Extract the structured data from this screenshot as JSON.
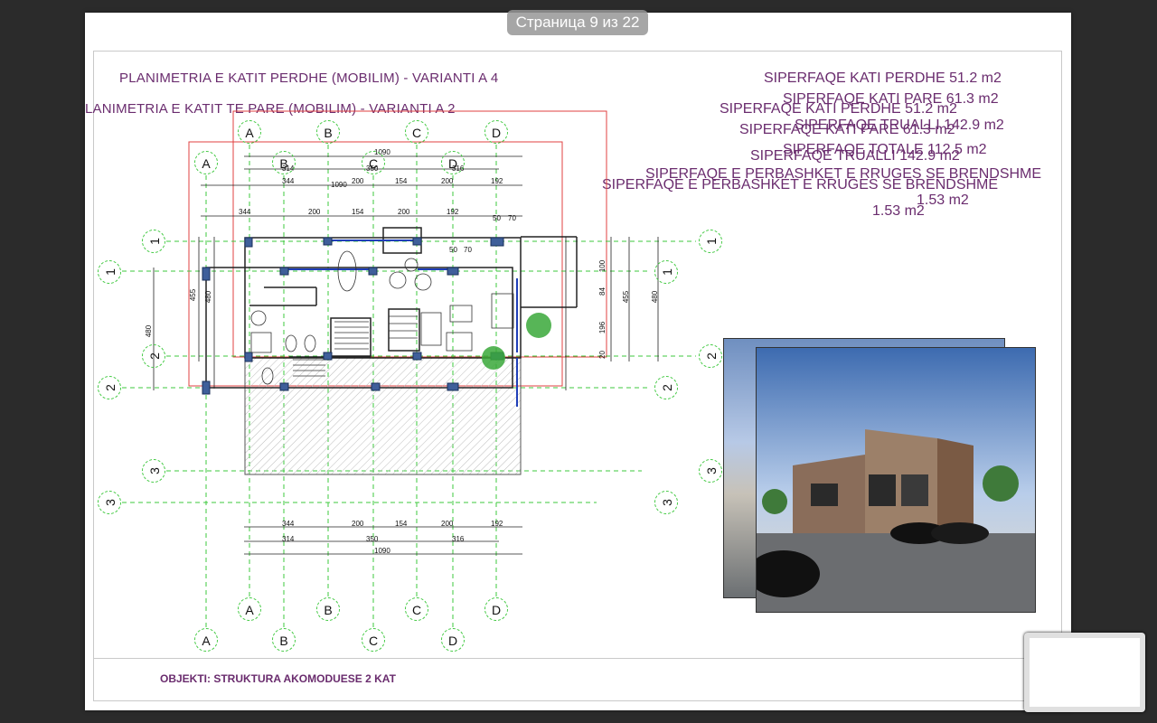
{
  "viewer": {
    "page_indicator": "Страница 9 из 22"
  },
  "sheet": {
    "title_upper": "PLANIMETRIA E KATIT PERDHE (MOBILIM) - VARIANTI A 4",
    "title_lower": "LANIMETRIA E KATIT TE PARE (MOBILIM) - VARIANTI A 2",
    "areas_set1": [
      "SIPERFAQE KATI PERDHE  51.2 m2",
      "SIPERFAQE KATI PARE  61.3 m2",
      "SIPERFAQE TRUALLI  142.9 m2",
      "SIPERFAQE TOTALE  112.5 m2",
      "SIPERFAQE E PERBASHKET E RRUGES SE BRENDSHME",
      "1.53 m2"
    ],
    "areas_set2": [
      "SIPERFAQE KATI PERDHE  51.2 m2",
      "SIPERFAQE KATI PARE  61.3 m2",
      "SIPERFAQE TRUALLI  142.9 m2",
      "SIPERFAQE E PERBASHKET E RRUGES SE BRENDSHME",
      "1.53 m2"
    ],
    "objekti": "OBJEKTI: STRUKTURA AKOMODUESE 2 KAT"
  },
  "plan": {
    "grid_cols_top": [
      "A",
      "B",
      "C",
      "D"
    ],
    "grid_cols_bottom": [
      "A",
      "B",
      "C",
      "D"
    ],
    "grid_rows": [
      "1",
      "2",
      "3"
    ],
    "dims_top_total": "1090",
    "dims_top_a": [
      "314",
      "350",
      "316"
    ],
    "dims_top_b": [
      "344",
      "200",
      "154",
      "200",
      "192"
    ],
    "dims_top_c": [
      "344",
      "200",
      "154",
      "200",
      "192"
    ],
    "dims_small": [
      "50",
      "70"
    ],
    "dims_bottom_a": [
      "344",
      "200",
      "154",
      "200",
      "192"
    ],
    "dims_bottom_b": [
      "314",
      "350",
      "316"
    ],
    "dims_bottom_total": "1090",
    "dims_left": [
      "480",
      "455",
      "480"
    ],
    "dims_right": [
      "100",
      "84",
      "196",
      "20",
      "455",
      "480"
    ]
  },
  "colors": {
    "title": "#6a2c6e",
    "grid": "#3ec83e",
    "wall": "#2b4a8a",
    "red_frame": "#e04040"
  }
}
